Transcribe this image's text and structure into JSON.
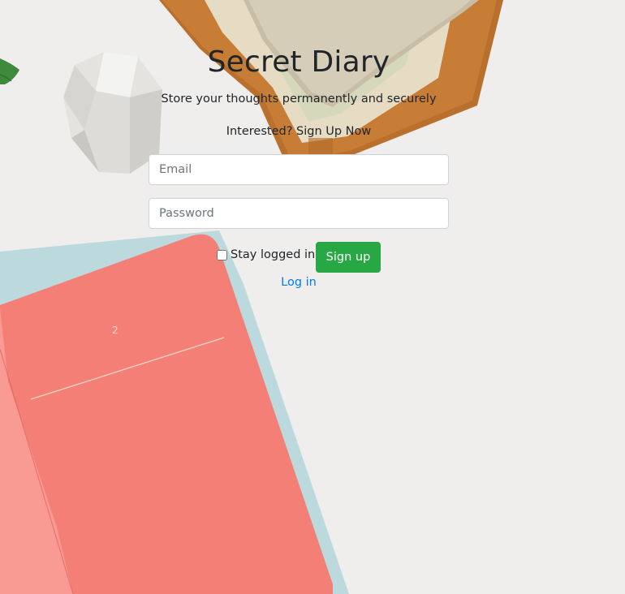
{
  "header": {
    "title": "Secret Diary",
    "subtitle": "Store your thoughts permanently and securely",
    "cta": "Interested? Sign Up Now"
  },
  "form": {
    "email_placeholder": "Email",
    "password_placeholder": "Password",
    "remember_label": "Stay logged in",
    "remember_checked": false,
    "submit_label": "Sign up",
    "toggle_link": "Log in"
  },
  "background": {
    "notebook_page_number": "2"
  },
  "colors": {
    "primary_button": "#28a745",
    "link": "#007bff",
    "text": "#212529"
  }
}
